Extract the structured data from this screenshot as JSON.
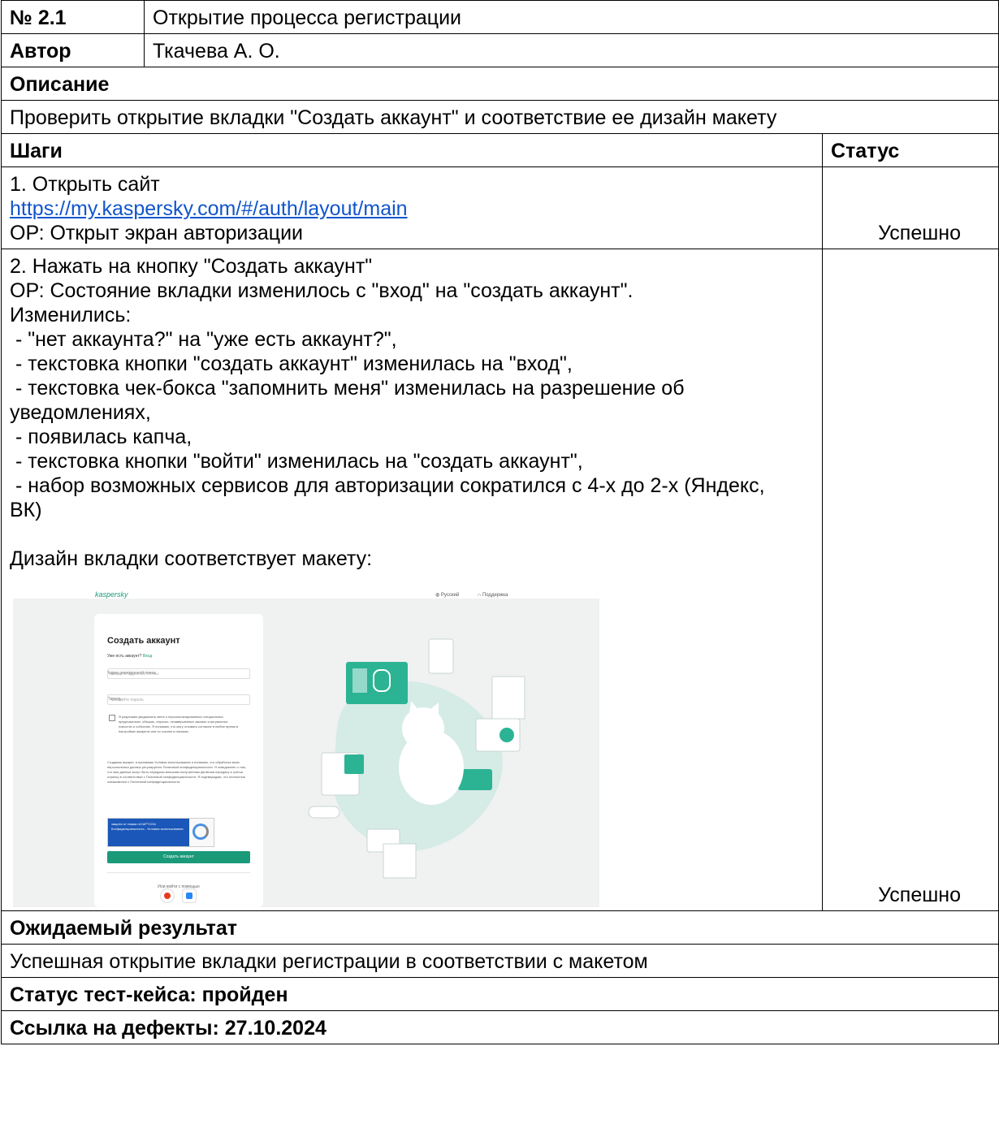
{
  "case": {
    "number_label": "№ 2.1",
    "title": "Открытие процесса регистрации",
    "author_label": "Автор",
    "author": "Ткачева А. О.",
    "description_label": "Описание",
    "description": "Проверить открытие вкладки \"Создать аккаунт\" и соответствие ее дизайн макету",
    "steps_label": "Шаги",
    "status_label": "Статус",
    "steps": [
      {
        "line1": "1. Открыть сайт",
        "link": "https://my.kaspersky.com/#/auth/layout/main",
        "line3": "ОР: Открыт экран авторизации",
        "status": "Успешно"
      },
      {
        "lines": [
          "2. Нажать на кнопку \"Создать аккаунт\"",
          "ОР: Состояние вкладки изменилось с \"вход\" на \"создать аккаунт\".",
          "Изменились:",
          " - \"нет аккаунта?\" на \"уже есть аккаунт?\",",
          " - текстовка кнопки \"создать аккаунт\" изменилась на \"вход\",",
          " - текстовка чек-бокса \"запомнить меня\" изменилась на разрешение об уведомлениях,",
          " - появилась капча,",
          " - текстовка кнопки \"войти\" изменилась на \"создать аккаунт\",",
          " - набор возможных сервисов для авторизации сократился с 4-х до 2-х (Яндекс, ВК)"
        ],
        "design_line": "Дизайн вкладки соответствует макету:",
        "status": "Успешно"
      }
    ],
    "expected_label": "Ожидаемый результат",
    "expected": "Успешная открытие вкладки регистрации в соответствии с макетом",
    "case_status": "Статус тест-кейса: пройден",
    "defects": "Ссылка на дефекты: 27.10.2024"
  },
  "screenshot": {
    "logo": "kaspersky",
    "lang": "Русский",
    "support": "Поддержка",
    "heading": "Создать аккаунт",
    "have_account": "Уже есть аккаунт?",
    "login_link": "Вход",
    "email_label": "Адрес электронной почты",
    "email_placeholder": "Введите адрес эл. почты",
    "password_label": "Пароль",
    "password_placeholder": "Создайте пароль",
    "consent": "Я разрешаю уведомлять меня о персонализированных специальных предложениях, обзорах, опросах, незавершенных заказах и актуальных новостях и событиях. Я понимаю, что могу отозвать согласие в любое время в настройках аккаунта или по ссылке в письмах.",
    "legal": "Создавая аккаунт, я принимаю Условия использования и понимаю, что обработка моих персональных данных регулируется Политикой конфиденциальности. Я осведомлен о том, что мои данные могут быть переданы внешним получателям (включая передачу в третьи страны) в соответствии с Политикой конфиденциальности. Я подтверждаю, что полностью ознакомился с Политикой конфиденциальности.",
    "captcha": "защита от спама reCAPTCHA Конфиденциальность - Условия использования",
    "create_button": "Создать аккаунт",
    "or_login": "Или войти с помощью"
  }
}
